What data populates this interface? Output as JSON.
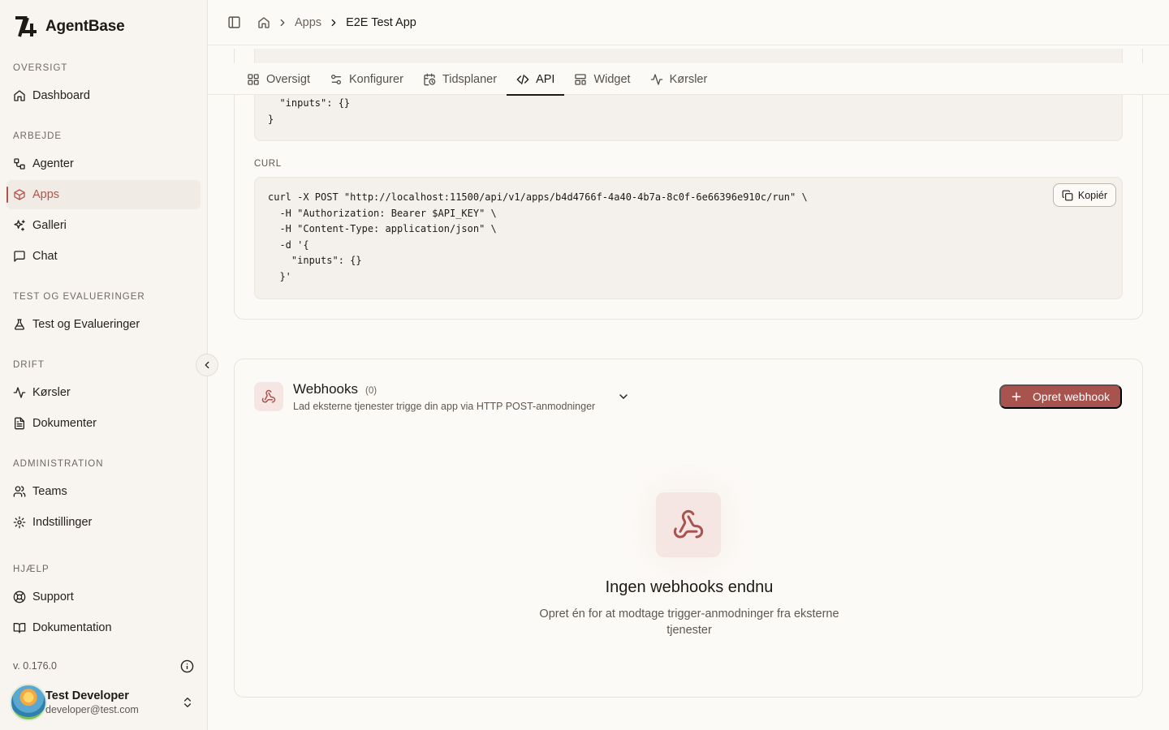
{
  "brand": {
    "name": "AgentBase"
  },
  "sidebar": {
    "sections": [
      {
        "label": "OVERSIGT",
        "items": [
          {
            "label": "Dashboard",
            "icon": "home-icon"
          }
        ]
      },
      {
        "label": "ARBEJDE",
        "items": [
          {
            "label": "Agenter",
            "icon": "workflow-icon"
          },
          {
            "label": "Apps",
            "icon": "box-icon",
            "active": true
          },
          {
            "label": "Galleri",
            "icon": "sparkles-icon"
          },
          {
            "label": "Chat",
            "icon": "message-square-icon"
          }
        ]
      },
      {
        "label": "TEST OG EVALUERINGER",
        "items": [
          {
            "label": "Test og Evalueringer",
            "icon": "flask-icon"
          }
        ]
      },
      {
        "label": "DRIFT",
        "items": [
          {
            "label": "Kørsler",
            "icon": "activity-icon"
          },
          {
            "label": "Dokumenter",
            "icon": "file-text-icon"
          }
        ]
      },
      {
        "label": "ADMINISTRATION",
        "items": [
          {
            "label": "Teams",
            "icon": "users-icon"
          },
          {
            "label": "Indstillinger",
            "icon": "gear-icon"
          }
        ]
      },
      {
        "label": "HJÆLP",
        "items": [
          {
            "label": "Support",
            "icon": "life-buoy-icon"
          },
          {
            "label": "Dokumentation",
            "icon": "book-icon"
          }
        ]
      }
    ],
    "version": "v. 0.176.0",
    "user": {
      "name": "Test Developer",
      "email": "developer@test.com"
    }
  },
  "breadcrumb": {
    "parent": "Apps",
    "current": "E2E Test App"
  },
  "tabs": [
    {
      "label": "Oversigt",
      "icon": "grid-icon"
    },
    {
      "label": "Konfigurer",
      "icon": "sliders-icon"
    },
    {
      "label": "Tidsplaner",
      "icon": "calendar-clock-icon"
    },
    {
      "label": "API",
      "icon": "code-icon",
      "active": true
    },
    {
      "label": "Widget",
      "icon": "layout-icon"
    },
    {
      "label": "Kørsler",
      "icon": "activity-icon"
    }
  ],
  "api": {
    "json_code_tail": "  \"inputs\": {}\n}",
    "curl_label": "CURL",
    "curl_code": "curl -X POST \"http://localhost:11500/api/v1/apps/b4d4766f-4a40-4b7a-8c0f-6e66396e910c/run\" \\\n  -H \"Authorization: Bearer $API_KEY\" \\\n  -H \"Content-Type: application/json\" \\\n  -d '{\n    \"inputs\": {}\n  }'",
    "copy_label": "Kopiér"
  },
  "webhooks": {
    "title": "Webhooks",
    "count": "(0)",
    "subtitle": "Lad eksterne tjenester trigge din app via HTTP POST-anmodninger",
    "create_label": "Opret webhook",
    "empty_title": "Ingen webhooks endnu",
    "empty_desc": "Opret én for at modtage trigger-anmodninger fra eksterne tjenester"
  },
  "colors": {
    "accent": "#b3534f",
    "button": "#a9534f",
    "background": "#fcfaf7",
    "sidebar": "#f8f5f0"
  }
}
